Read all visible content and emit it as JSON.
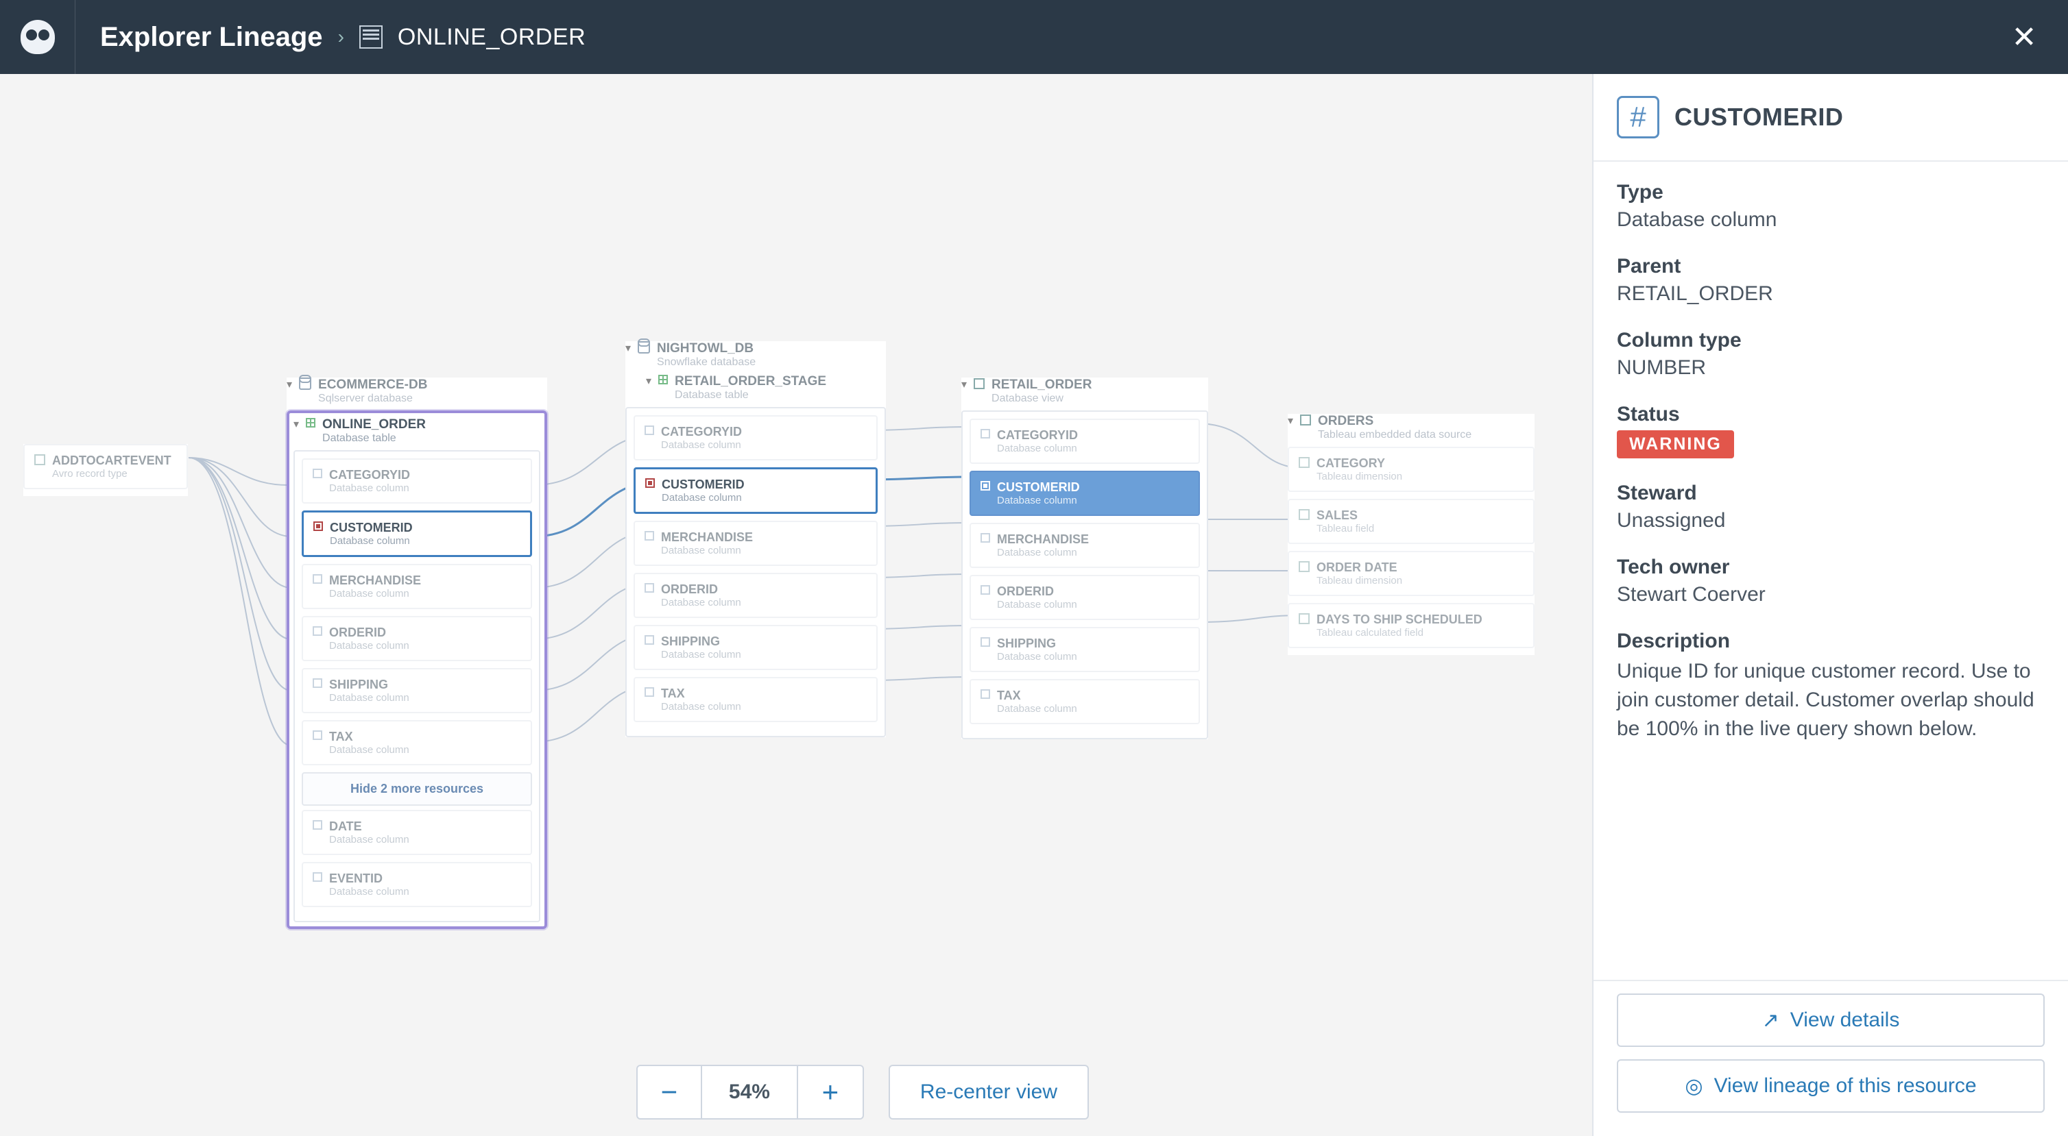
{
  "header": {
    "title": "Explorer Lineage",
    "breadcrumb_resource": "ONLINE_ORDER"
  },
  "toolbar": {
    "zoom_out": "−",
    "zoom_pct": "54%",
    "zoom_in": "+",
    "recenter": "Re-center view"
  },
  "side_panel": {
    "name": "CUSTOMERID",
    "fields": {
      "type_label": "Type",
      "type_value": "Database column",
      "parent_label": "Parent",
      "parent_value": "RETAIL_ORDER",
      "coltype_label": "Column type",
      "coltype_value": "NUMBER",
      "status_label": "Status",
      "status_value": "WARNING",
      "steward_label": "Steward",
      "steward_value": "Unassigned",
      "techowner_label": "Tech owner",
      "techowner_value": "Stewart Coerver",
      "desc_label": "Description",
      "desc_value": "Unique ID for unique customer record. Use to join customer detail. Customer overlap should be 100% in the live query shown below."
    },
    "view_details": "View details",
    "view_lineage": "View lineage of this resource"
  },
  "canvas": {
    "left_chip": {
      "name": "ADDTOCARTEVENT",
      "sub": "Avro record type"
    },
    "ecommerce_db": {
      "name": "ECOMMERCE-DB",
      "sub": "Sqlserver database"
    },
    "online_order": {
      "name": "ONLINE_ORDER",
      "sub": "Database table"
    },
    "online_order_cols": [
      {
        "name": "CATEGORYID",
        "sub": "Database column"
      },
      {
        "name": "CUSTOMERID",
        "sub": "Database column",
        "selected": true
      },
      {
        "name": "MERCHANDISE",
        "sub": "Database column"
      },
      {
        "name": "ORDERID",
        "sub": "Database column"
      },
      {
        "name": "SHIPPING",
        "sub": "Database column"
      },
      {
        "name": "TAX",
        "sub": "Database column"
      }
    ],
    "hide_more": "Hide 2 more resources",
    "online_order_extra": [
      {
        "name": "DATE",
        "sub": "Database column"
      },
      {
        "name": "EVENTID",
        "sub": "Database column"
      }
    ],
    "nightowl_db": {
      "name": "NIGHTOWL_DB",
      "sub": "Snowflake database"
    },
    "retail_stage": {
      "name": "RETAIL_ORDER_STAGE",
      "sub": "Database table"
    },
    "stage_cols": [
      {
        "name": "CATEGORYID",
        "sub": "Database column"
      },
      {
        "name": "CUSTOMERID",
        "sub": "Database column",
        "selected": true
      },
      {
        "name": "MERCHANDISE",
        "sub": "Database column"
      },
      {
        "name": "ORDERID",
        "sub": "Database column"
      },
      {
        "name": "SHIPPING",
        "sub": "Database column"
      },
      {
        "name": "TAX",
        "sub": "Database column"
      }
    ],
    "retail_order": {
      "name": "RETAIL_ORDER",
      "sub": "Database view"
    },
    "retail_cols": [
      {
        "name": "CATEGORYID",
        "sub": "Database column"
      },
      {
        "name": "CUSTOMERID",
        "sub": "Database column",
        "active": true
      },
      {
        "name": "MERCHANDISE",
        "sub": "Database column"
      },
      {
        "name": "ORDERID",
        "sub": "Database column"
      },
      {
        "name": "SHIPPING",
        "sub": "Database column"
      },
      {
        "name": "TAX",
        "sub": "Database column"
      }
    ],
    "orders": {
      "name": "ORDERS",
      "sub": "Tableau embedded data source"
    },
    "orders_items": [
      {
        "name": "CATEGORY",
        "sub": "Tableau dimension"
      },
      {
        "name": "SALES",
        "sub": "Tableau field"
      },
      {
        "name": "ORDER DATE",
        "sub": "Tableau dimension"
      },
      {
        "name": "DAYS TO SHIP SCHEDULED",
        "sub": "Tableau calculated field"
      }
    ]
  }
}
